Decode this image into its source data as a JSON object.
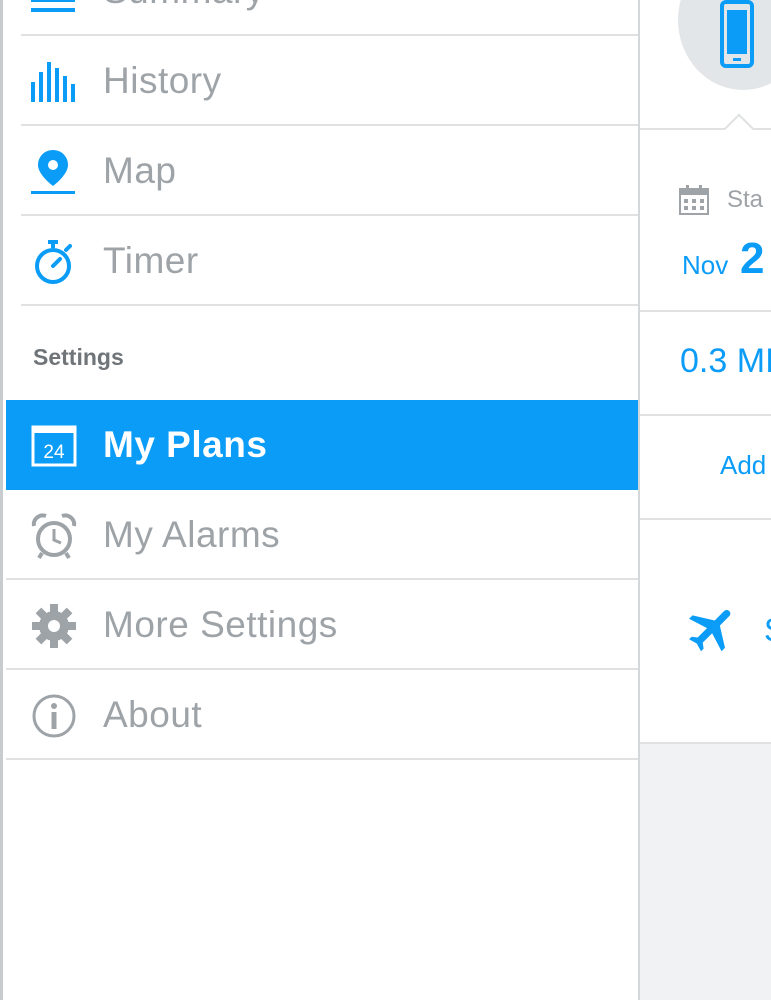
{
  "sidebar": {
    "items": [
      {
        "label": "Summary",
        "icon": "summary-bars-icon"
      },
      {
        "label": "History",
        "icon": "history-chart-icon"
      },
      {
        "label": "Map",
        "icon": "map-pin-icon"
      },
      {
        "label": "Timer",
        "icon": "stopwatch-icon"
      }
    ],
    "settings_header": "Settings",
    "settings_items": [
      {
        "label": "My Plans",
        "icon": "calendar-24-icon",
        "active": true
      },
      {
        "label": "My Alarms",
        "icon": "alarm-clock-icon"
      },
      {
        "label": "More Settings",
        "icon": "gear-icon"
      },
      {
        "label": "About",
        "icon": "info-icon"
      }
    ],
    "calendar_number": "24"
  },
  "main": {
    "device_icon": "phone-icon",
    "start_label": "Sta",
    "start_month": "Nov",
    "start_day": "2",
    "distance": "0.3 MI",
    "add_link": "Add",
    "travel_label": "S",
    "travel_icon": "airplane-icon"
  },
  "colors": {
    "accent": "#0a9cf7",
    "muted_text": "#9ea3a8",
    "divider": "#dfe1e3",
    "panel_bg": "#f0f2f3"
  }
}
